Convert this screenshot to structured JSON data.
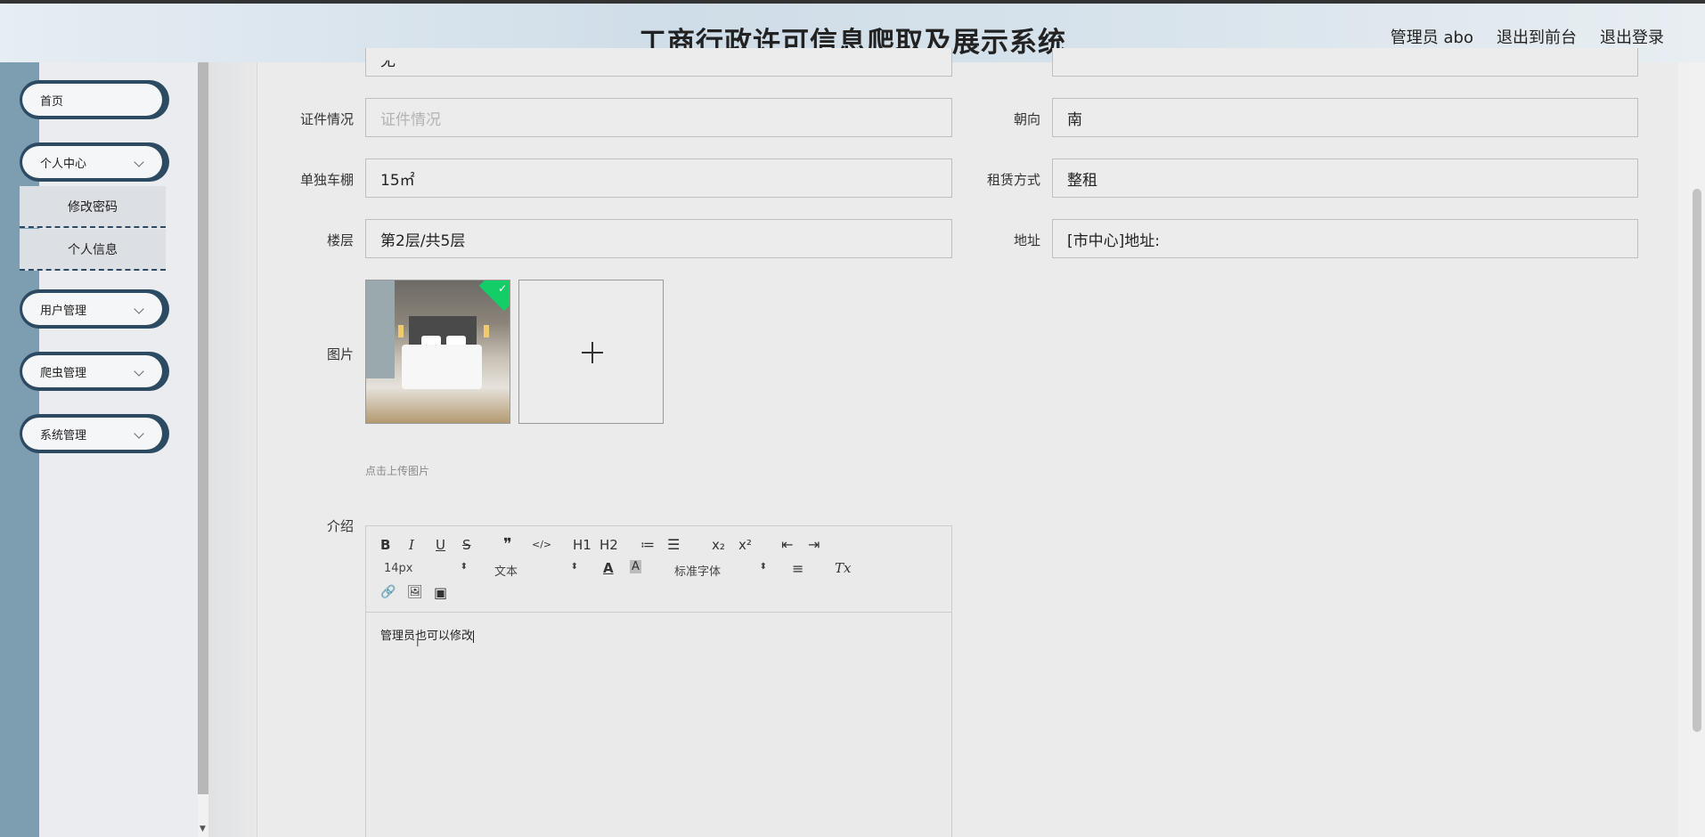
{
  "header": {
    "title": "工商行政许可信息爬取及展示系统",
    "user": "管理员 abo",
    "back_front": "退出到前台",
    "logout": "退出登录"
  },
  "sidebar": {
    "items": [
      {
        "label": "首页"
      },
      {
        "label": "个人中心"
      },
      {
        "label": "用户管理"
      },
      {
        "label": "爬虫管理"
      },
      {
        "label": "系统管理"
      }
    ],
    "sub_items": [
      {
        "label": "修改密码"
      },
      {
        "label": "个人信息"
      }
    ]
  },
  "form": {
    "top_left_value": "无",
    "cert_label": "证件情况",
    "cert_placeholder": "证件情况",
    "orient_label": "朝向",
    "orient_value": "南",
    "garage_label": "单独车棚",
    "garage_value": "15㎡",
    "rent_label": "租赁方式",
    "rent_value": "整租",
    "floor_label": "楼层",
    "floor_value": "第2层/共5层",
    "addr_label": "地址",
    "addr_value": "[市中心]地址:",
    "image_label": "图片",
    "upload_hint": "点击上传图片",
    "intro_label": "介绍"
  },
  "editor": {
    "toolbar": {
      "bold": "B",
      "italic": "I",
      "underline": "U",
      "strike": "S",
      "quote": "❞",
      "code": "</>",
      "h1": "H1",
      "h2": "H2",
      "ordered": "≔",
      "bullet": "☰",
      "sub": "x₂",
      "sup": "x²",
      "outdent": "⇤",
      "indent": "⇥",
      "size": "14px",
      "header_select": "文本",
      "color": "A",
      "bg": "A",
      "font": "标准字体",
      "align": "≡",
      "clean": "Tx",
      "link": "🔗",
      "image": "🖼",
      "video": "▣"
    },
    "content": "管理员也可以修改"
  },
  "colors": {
    "sidebar_border": "#2d4a63",
    "sidebar_strip": "#7d9db1",
    "success_badge": "#13ce66"
  }
}
